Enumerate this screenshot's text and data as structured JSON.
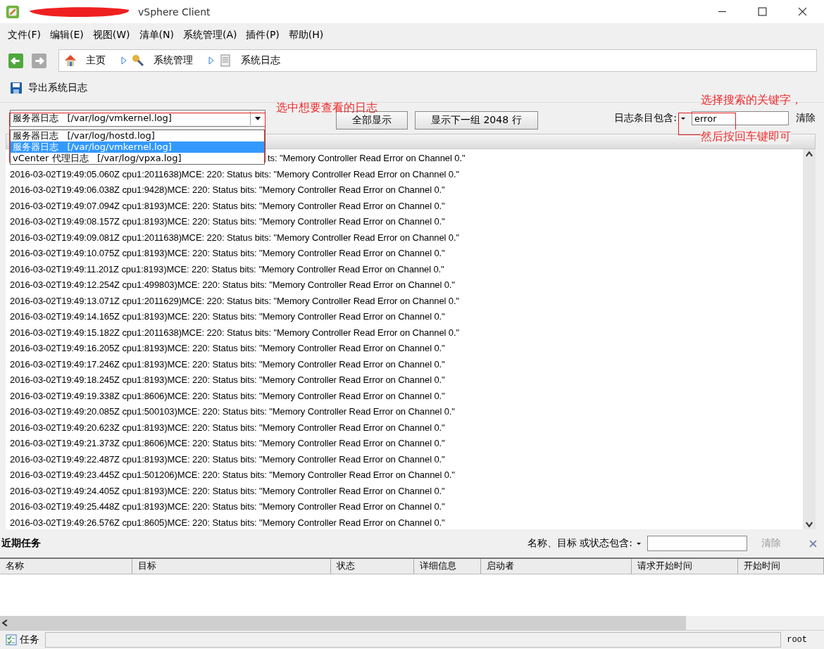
{
  "window": {
    "title": "vSphere Client"
  },
  "menu": [
    "文件(F)",
    "编辑(E)",
    "视图(W)",
    "清单(N)",
    "系统管理(A)",
    "插件(P)",
    "帮助(H)"
  ],
  "breadcrumb": [
    "主页",
    "系统管理",
    "系统日志"
  ],
  "toolbar": {
    "export": "导出系统日志"
  },
  "log_select": {
    "value": "服务器日志   [/var/log/vmkernel.log]",
    "expanded": true,
    "options": [
      {
        "label": "服务器日志   [/var/log/hostd.log]",
        "selected": false
      },
      {
        "label": "服务器日志   [/var/log/vmkernel.log]",
        "selected": true
      },
      {
        "label": "vCenter 代理日志   [/var/log/vpxa.log]",
        "selected": false
      }
    ]
  },
  "buttons": [
    "全部显示",
    "显示下一组 2048 行"
  ],
  "filter": {
    "label": "日志条目包含:",
    "value": "error",
    "clear": "清除"
  },
  "annotations": [
    "选中想要查看的日志",
    "选择搜索的关键字，",
    "然后按回车键即可"
  ],
  "log_lines": [
    {
      "kind": "partial",
      "text": "ts: \"Memory Controller Read Error on Channel 0.\""
    },
    {
      "kind": "full",
      "text": "2016-03-02T19:49:05.060Z cpu1:2011638)MCE: 220: Status bits: \"Memory Controller Read Error on Channel 0.\""
    },
    {
      "kind": "full",
      "text": "2016-03-02T19:49:06.038Z cpu1:9428)MCE: 220: Status bits: \"Memory Controller Read Error on Channel 0.\""
    },
    {
      "kind": "full",
      "text": "2016-03-02T19:49:07.094Z cpu1:8193)MCE: 220: Status bits: \"Memory Controller Read Error on Channel 0.\""
    },
    {
      "kind": "full",
      "text": "2016-03-02T19:49:08.157Z cpu1:8193)MCE: 220: Status bits: \"Memory Controller Read Error on Channel 0.\""
    },
    {
      "kind": "full",
      "text": "2016-03-02T19:49:09.081Z cpu1:2011638)MCE: 220: Status bits: \"Memory Controller Read Error on Channel 0.\""
    },
    {
      "kind": "full",
      "text": "2016-03-02T19:49:10.075Z cpu1:8193)MCE: 220: Status bits: \"Memory Controller Read Error on Channel 0.\""
    },
    {
      "kind": "full",
      "text": "2016-03-02T19:49:11.201Z cpu1:8193)MCE: 220: Status bits: \"Memory Controller Read Error on Channel 0.\""
    },
    {
      "kind": "full",
      "text": "2016-03-02T19:49:12.254Z cpu1:499803)MCE: 220: Status bits: \"Memory Controller Read Error on Channel 0.\""
    },
    {
      "kind": "full",
      "text": "2016-03-02T19:49:13.071Z cpu1:2011629)MCE: 220: Status bits: \"Memory Controller Read Error on Channel 0.\""
    },
    {
      "kind": "full",
      "text": "2016-03-02T19:49:14.165Z cpu1:8193)MCE: 220: Status bits: \"Memory Controller Read Error on Channel 0.\""
    },
    {
      "kind": "full",
      "text": "2016-03-02T19:49:15.182Z cpu1:2011638)MCE: 220: Status bits: \"Memory Controller Read Error on Channel 0.\""
    },
    {
      "kind": "full",
      "text": "2016-03-02T19:49:16.205Z cpu1:8193)MCE: 220: Status bits: \"Memory Controller Read Error on Channel 0.\""
    },
    {
      "kind": "full",
      "text": "2016-03-02T19:49:17.246Z cpu1:8193)MCE: 220: Status bits: \"Memory Controller Read Error on Channel 0.\""
    },
    {
      "kind": "full",
      "text": "2016-03-02T19:49:18.245Z cpu1:8193)MCE: 220: Status bits: \"Memory Controller Read Error on Channel 0.\""
    },
    {
      "kind": "full",
      "text": "2016-03-02T19:49:19.338Z cpu1:8606)MCE: 220: Status bits: \"Memory Controller Read Error on Channel 0.\""
    },
    {
      "kind": "full",
      "text": "2016-03-02T19:49:20.085Z cpu1:500103)MCE: 220: Status bits: \"Memory Controller Read Error on Channel 0.\""
    },
    {
      "kind": "full",
      "text": "2016-03-02T19:49:20.623Z cpu1:8193)MCE: 220: Status bits: \"Memory Controller Read Error on Channel 0.\""
    },
    {
      "kind": "full",
      "text": "2016-03-02T19:49:21.373Z cpu1:8606)MCE: 220: Status bits: \"Memory Controller Read Error on Channel 0.\""
    },
    {
      "kind": "full",
      "text": "2016-03-02T19:49:22.487Z cpu1:8193)MCE: 220: Status bits: \"Memory Controller Read Error on Channel 0.\""
    },
    {
      "kind": "full",
      "text": "2016-03-02T19:49:23.445Z cpu1:501206)MCE: 220: Status bits: \"Memory Controller Read Error on Channel 0.\""
    },
    {
      "kind": "full",
      "text": "2016-03-02T19:49:24.405Z cpu1:8193)MCE: 220: Status bits: \"Memory Controller Read Error on Channel 0.\""
    },
    {
      "kind": "full",
      "text": "2016-03-02T19:49:25.448Z cpu1:8193)MCE: 220: Status bits: \"Memory Controller Read Error on Channel 0.\""
    },
    {
      "kind": "full",
      "text": "2016-03-02T19:49:26.576Z cpu1:8605)MCE: 220: Status bits: \"Memory Controller Read Error on Channel 0.\""
    }
  ],
  "recent_tasks": {
    "title": "近期任务",
    "filter_label": "名称、目标 或状态包含:",
    "clear": "清除",
    "columns": [
      "名称",
      "目标",
      "状态",
      "详细信息",
      "启动者",
      "请求开始时间",
      "开始时间"
    ]
  },
  "status_bar": {
    "tasks": "任务",
    "user": "root"
  }
}
